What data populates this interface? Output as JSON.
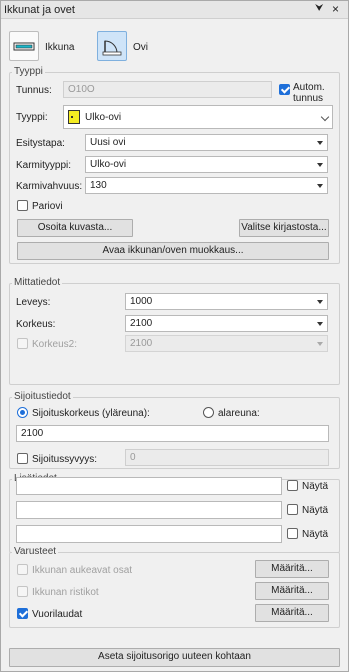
{
  "window": {
    "title": "Ikkunat ja ovet",
    "pin_glyph": "⮟",
    "close_glyph": "×"
  },
  "modes": {
    "window_label": "Ikkuna",
    "door_label": "Ovi",
    "active": "door"
  },
  "type_group": {
    "title": "Tyyppi",
    "id_label": "Tunnus:",
    "id_value": "O10O",
    "auto_id_label_line1": "Autom.",
    "auto_id_label_line2": "tunnus",
    "auto_id_checked": true,
    "type_label": "Tyyppi:",
    "type_value": "Ulko-ovi",
    "type_icon": "yellow-door-swatch",
    "presentation_label": "Esitystapa:",
    "presentation_value": "Uusi ovi",
    "frame_type_label": "Karmityyppi:",
    "frame_type_value": "Ulko-ovi",
    "frame_thickness_label": "Karmivahvuus:",
    "frame_thickness_value": "130",
    "double_door_label": "Pariovi",
    "double_door_checked": false,
    "pick_from_drawing_label": "Osoita kuvasta...",
    "pick_from_library_label": "Valitse kirjastosta...",
    "open_editor_label": "Avaa ikkunan/oven muokkaus..."
  },
  "dimensions": {
    "title": "Mittatiedot",
    "width_label": "Leveys:",
    "width_value": "1000",
    "height_label": "Korkeus:",
    "height_value": "2100",
    "height2_label": "Korkeus2:",
    "height2_value": "2100",
    "height2_checked": false
  },
  "placement": {
    "title": "Sijoitustiedot",
    "top_edge_label": "Sijoituskorkeus (yläreuna):",
    "bottom_edge_label": "alareuna:",
    "selected": "top",
    "height_value": "2100",
    "depth_label": "Sijoitussyvyys:",
    "depth_value": "0",
    "depth_checked": false
  },
  "extra_info": {
    "title": "Lisätiedot",
    "rows": [
      {
        "value": "",
        "show_label": "Näytä",
        "checked": false
      },
      {
        "value": "",
        "show_label": "Näytä",
        "checked": false
      },
      {
        "value": "",
        "show_label": "Näytä",
        "checked": false
      }
    ]
  },
  "accessories": {
    "title": "Varusteet",
    "items": [
      {
        "label": "Ikkunan aukeavat osat",
        "checked": false,
        "enabled": false,
        "button": "Määritä..."
      },
      {
        "label": "Ikkunan ristikot",
        "checked": false,
        "enabled": false,
        "button": "Määritä..."
      },
      {
        "label": "Vuorilaudat",
        "checked": true,
        "enabled": true,
        "button": "Määritä..."
      }
    ]
  },
  "footer": {
    "set_origin_label": "Aseta sijoitusorigo uuteen kohtaan"
  }
}
